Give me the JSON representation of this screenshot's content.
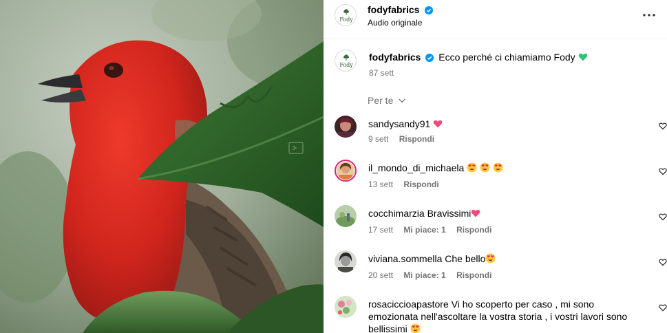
{
  "post": {
    "author": "fodyfabrics",
    "audio": "Audio originale",
    "logo_text": "Fody",
    "caption_user": "fodyfabrics",
    "caption_text": "Ecco perché ci chiamiamo Fody",
    "caption_time": "87 sett"
  },
  "filter": {
    "label": "Per te"
  },
  "comments": [
    {
      "user": "sandysandy91",
      "text": "",
      "time": "9 sett",
      "likes": "",
      "reply": "Rispondi"
    },
    {
      "user": "il_mondo_di_michaela",
      "text": "",
      "time": "13 sett",
      "likes": "",
      "reply": "Rispondi"
    },
    {
      "user": "cocchimarzia",
      "text": "Bravissimi",
      "time": "17 sett",
      "likes": "Mi piace: 1",
      "reply": "Rispondi"
    },
    {
      "user": "viviana.sommella",
      "text": "Che bello",
      "time": "20 sett",
      "likes": "Mi piace: 1",
      "reply": "Rispondi"
    },
    {
      "user": "rosaciccioapastore",
      "text": "Vi ho scoperto per caso , mi sono emozionata nell'ascoltare la vostra storia , i vostri lavori sono bellissimi",
      "time": "",
      "likes": "",
      "reply": ""
    }
  ],
  "icons": {
    "verified": "verified-badge-icon",
    "more": "more-options-icon",
    "chevron": "chevron-down-icon",
    "like": "heart-outline-icon",
    "emoji_heart": "pink-heart-emoji",
    "emoji_green_heart": "green-heart-emoji",
    "emoji_heart_eyes": "heart-eyes-emoji"
  },
  "colors": {
    "verified": "#0095f6",
    "secondary_text": "#737373",
    "bird_red": "#d42a22"
  }
}
